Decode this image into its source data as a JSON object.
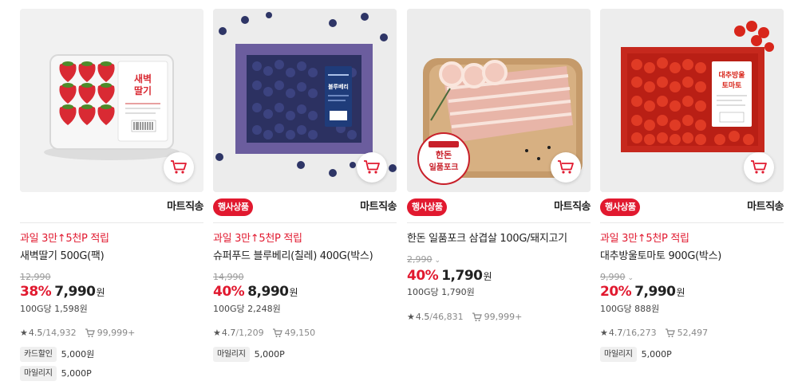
{
  "products": [
    {
      "image_alt": "새벽딸기",
      "image_label": "새벽\n딸기",
      "badge": "",
      "delivery": "마트직송",
      "promo": "과일 3만↑5천P 적립",
      "title": "새벽딸기 500G(팩)",
      "original_price": "12,990",
      "discount_rate": "38%",
      "price": "7,990",
      "currency": "원",
      "unit_price": "100G당 1,598원",
      "rating": "4.5",
      "review_count": "14,932",
      "purchase_count": "99,999+",
      "tags": [
        {
          "label": "카드할인",
          "value": "5,000원"
        },
        {
          "label": "마일리지",
          "value": "5,000P"
        }
      ]
    },
    {
      "image_alt": "블루베리",
      "image_label": "블루베리",
      "badge": "행사상품",
      "delivery": "마트직송",
      "promo": "과일 3만↑5천P 적립",
      "title": "슈퍼푸드 블루베리(칠레) 400G(박스)",
      "original_price": "14,990",
      "discount_rate": "40%",
      "price": "8,990",
      "currency": "원",
      "unit_price": "100G당 2,248원",
      "rating": "4.7",
      "review_count": "1,209",
      "purchase_count": "49,150",
      "tags": [
        {
          "label": "마일리지",
          "value": "5,000P"
        }
      ]
    },
    {
      "image_alt": "한돈 일품포크",
      "image_label": "한돈\n일품포크",
      "badge": "행사상품",
      "delivery": "마트직송",
      "promo": "",
      "title": "한돈 일품포크 삼겹살 100G/돼지고기",
      "original_price": "2,990",
      "discount_rate": "40%",
      "price": "1,790",
      "currency": "원",
      "unit_price": "100G당 1,790원",
      "rating": "4.5",
      "review_count": "46,831",
      "purchase_count": "99,999+",
      "tags": []
    },
    {
      "image_alt": "대추방울토마토",
      "image_label": "대추방울\n토마토",
      "badge": "행사상품",
      "delivery": "마트직송",
      "promo": "과일 3만↑5천P 적립",
      "title": "대추방울토마토 900G(박스)",
      "original_price": "9,990",
      "discount_rate": "20%",
      "price": "7,990",
      "currency": "원",
      "unit_price": "100G당 888원",
      "rating": "4.7",
      "review_count": "16,273",
      "purchase_count": "52,497",
      "tags": [
        {
          "label": "마일리지",
          "value": "5,000P"
        }
      ]
    }
  ],
  "icons": {
    "cart": "cart-icon",
    "star": "star-icon",
    "purchase": "purchase-count-icon",
    "dropdown": "chevron-down-icon"
  },
  "colors": {
    "accent": "#e1192f",
    "strawberry": "#d92a33",
    "blueberry": "#2e3566",
    "pork": "#e8b5a8",
    "tomato": "#d8261b"
  }
}
